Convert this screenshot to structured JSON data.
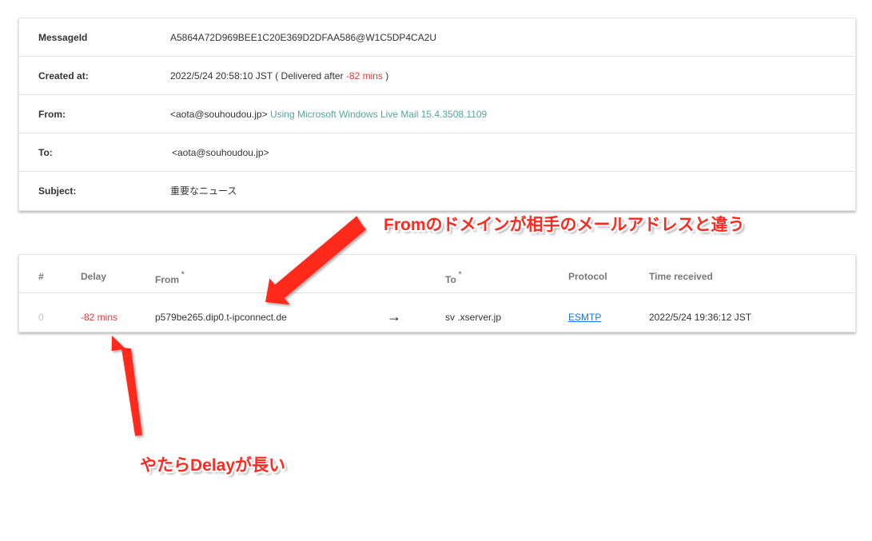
{
  "summary": {
    "message_id": {
      "label": "MessageId",
      "value": "A5864A72D969BEE1C20E369D2DFAA586@W1C5DP4CA2U"
    },
    "created_at": {
      "label": "Created at:",
      "prefix": "2022/5/24 20:58:10 JST ( Delivered after ",
      "delay": "-82 mins",
      "suffix": " )"
    },
    "from": {
      "label": "From:",
      "address": "<aota@souhoudou.jp>",
      "agent": "Using Microsoft Windows Live Mail 15.4.3508.1109"
    },
    "to": {
      "label": "To:",
      "address": "<aota@souhoudou.jp>"
    },
    "subject": {
      "label": "Subject:",
      "value": "重要なニュース"
    }
  },
  "hops": {
    "headers": {
      "index": "#",
      "delay": "Delay",
      "from": "From",
      "from_mark": "*",
      "to": "To",
      "to_mark": "*",
      "protocol": "Protocol",
      "time": "Time received"
    },
    "rows": [
      {
        "index": "0",
        "delay": "-82 mins",
        "from": "p579be265.dip0.t-ipconnect.de",
        "arrow": "→",
        "to": "sv   .xserver.jp",
        "protocol": "ESMTP",
        "time": "2022/5/24 19:36:12 JST"
      }
    ]
  },
  "annotations": {
    "from_domain": "Fromのドメインが相手のメールアドレスと違う",
    "delay_long": "やたらDelayが長い"
  },
  "colors": {
    "delay": "#e53935",
    "agent": "#52a894",
    "annotation": "#ff2a1f",
    "link": "#1a73e8"
  }
}
